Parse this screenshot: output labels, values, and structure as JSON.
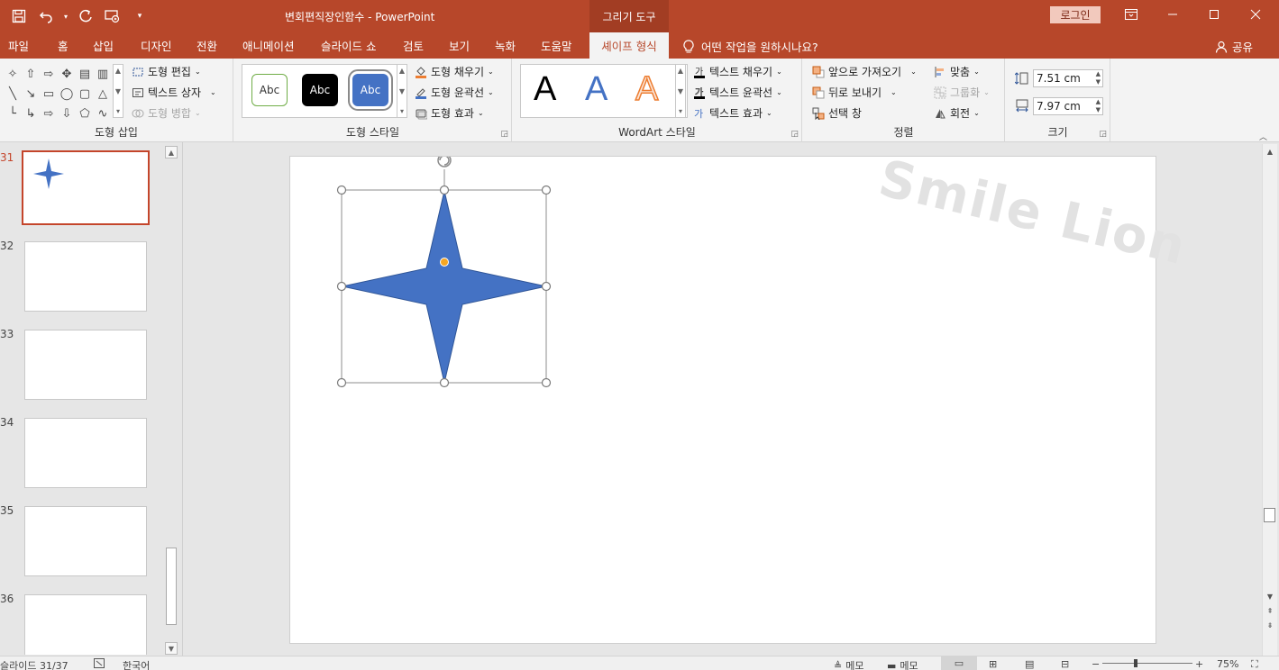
{
  "titlebar": {
    "doc_title": "변회편직장인함수  -  PowerPoint",
    "context_tab": "그리기 도구",
    "login": "로그인",
    "bg_color": "#b7472a"
  },
  "tabs": {
    "file": "파일",
    "home": "홈",
    "insert": "삽입",
    "design": "디자인",
    "transitions": "전환",
    "animations": "애니메이션",
    "slideshow": "슬라이드 쇼",
    "review": "검토",
    "view": "보기",
    "recording": "녹화",
    "help": "도움말",
    "shape_format": "셰이프 형식",
    "tell_me": "어떤 작업을 원하시나요?",
    "share": "공유"
  },
  "ribbon": {
    "insert_shapes": {
      "label": "도형 삽입",
      "edit_shape": "도형 편집",
      "text_box": "텍스트 상자",
      "merge_shapes": "도형 병합"
    },
    "shape_styles": {
      "label": "도형 스타일",
      "preview_text": "Abc",
      "fill": "도형 채우기",
      "outline": "도형 윤곽선",
      "effects": "도형 효과"
    },
    "wordart": {
      "label": "WordArt 스타일",
      "glyph": "A",
      "text_fill": "텍스트 채우기",
      "text_outline": "텍스트 윤곽선",
      "text_effects": "텍스트 효과"
    },
    "arrange": {
      "label": "정렬",
      "bring_forward": "앞으로 가져오기",
      "send_backward": "뒤로 보내기",
      "selection_pane": "선택 창",
      "align": "맞춤",
      "group": "그룹화",
      "rotate": "회전"
    },
    "size": {
      "label": "크기",
      "height": "7.51 cm",
      "width": "7.97 cm"
    }
  },
  "thumbnails": {
    "n31": "31",
    "n32": "32",
    "n33": "33",
    "n34": "34",
    "n35": "35",
    "n36": "36"
  },
  "slide": {
    "watermark": "Smile Lion",
    "shape_color": "#4472c4"
  },
  "statusbar": {
    "slide_info": "슬라이드 31/37",
    "language": "한국어",
    "notes": "메모",
    "comments": "메모",
    "zoom": "75%"
  }
}
